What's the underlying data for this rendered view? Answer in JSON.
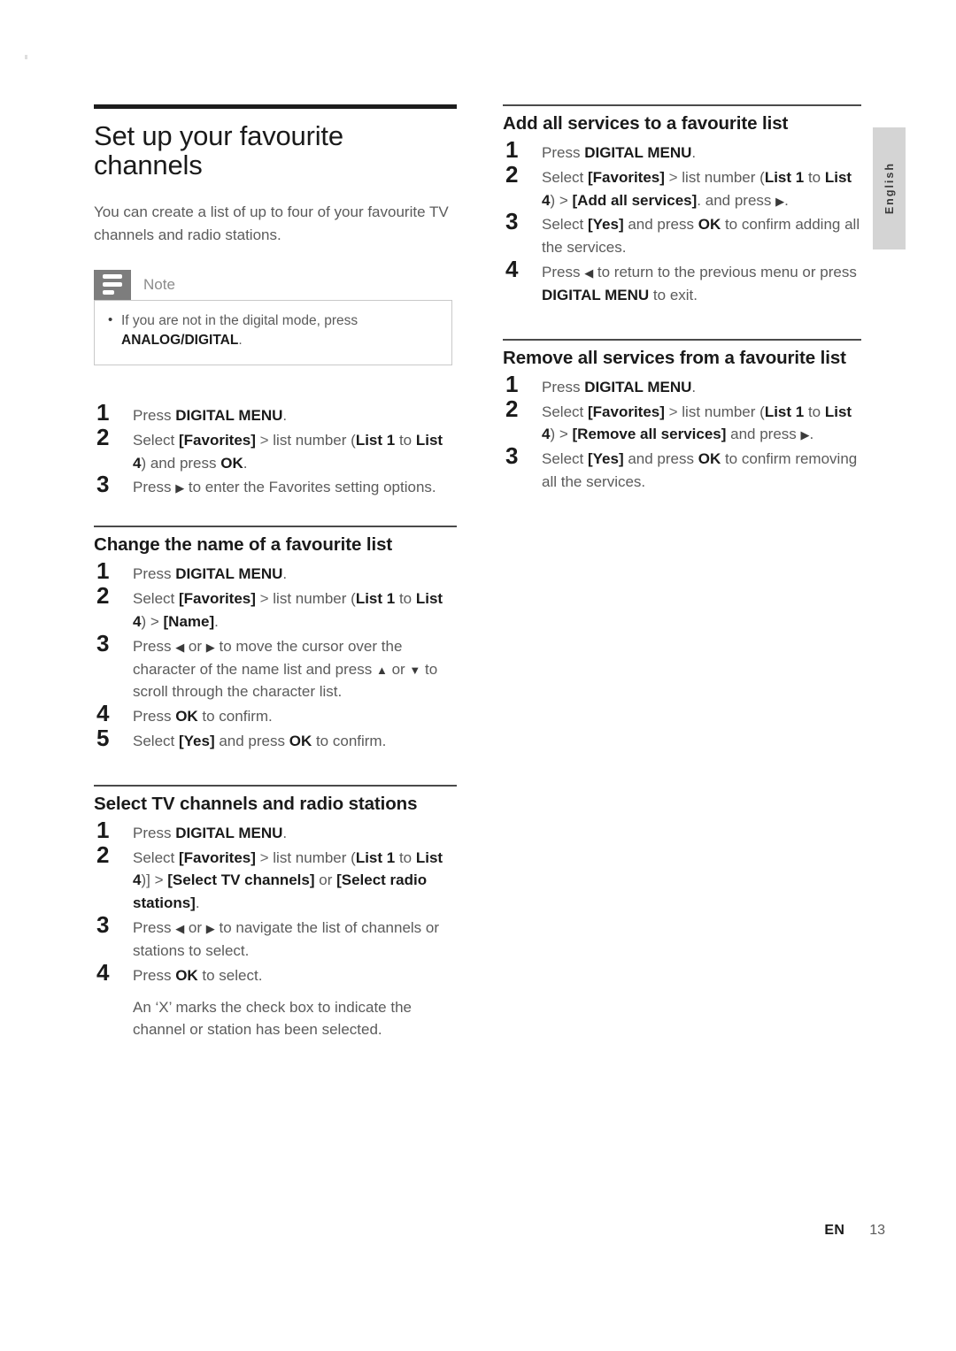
{
  "language_tab": {
    "label": "English"
  },
  "footer": {
    "code": "EN",
    "page": "13"
  },
  "left_column": {
    "title": "Set up your favourite channels",
    "intro": "You can create a list of up to four of your favourite TV channels and radio stations.",
    "note": {
      "label": "Note",
      "items": [
        {
          "text_before": "If you are not in the digital mode, press ",
          "bold": "ANALOG/DIGITAL",
          "text_after": "."
        }
      ]
    },
    "main_steps": [
      {
        "n": "1",
        "parts": [
          {
            "t": "Press ",
            "s": "normal"
          },
          {
            "t": "DIGITAL MENU",
            "s": "bold"
          },
          {
            "t": ".",
            "s": "normal"
          }
        ]
      },
      {
        "n": "2",
        "parts": [
          {
            "t": "Select ",
            "s": "normal"
          },
          {
            "t": "[Favorites]",
            "s": "bold"
          },
          {
            "t": " > ",
            "s": "gt"
          },
          {
            "t": "list number (",
            "s": "normal"
          },
          {
            "t": "List 1",
            "s": "bold"
          },
          {
            "t": " to ",
            "s": "normal"
          },
          {
            "t": "List 4",
            "s": "bold"
          },
          {
            "t": ") and press ",
            "s": "normal"
          },
          {
            "t": "OK",
            "s": "bold"
          },
          {
            "t": ".",
            "s": "normal"
          }
        ]
      },
      {
        "n": "3",
        "parts": [
          {
            "t": "Press ",
            "s": "normal"
          },
          {
            "t": "▶",
            "s": "arrow"
          },
          {
            "t": " to enter the Favorites setting options.",
            "s": "normal"
          }
        ]
      }
    ],
    "sections": [
      {
        "heading": "Change the name of a favourite list",
        "steps": [
          {
            "n": "1",
            "parts": [
              {
                "t": "Press ",
                "s": "normal"
              },
              {
                "t": "DIGITAL MENU",
                "s": "bold"
              },
              {
                "t": ".",
                "s": "normal"
              }
            ]
          },
          {
            "n": "2",
            "parts": [
              {
                "t": "Select ",
                "s": "normal"
              },
              {
                "t": "[Favorites]",
                "s": "bold"
              },
              {
                "t": " > ",
                "s": "gt"
              },
              {
                "t": "list number (",
                "s": "normal"
              },
              {
                "t": "List 1",
                "s": "bold"
              },
              {
                "t": " to ",
                "s": "normal"
              },
              {
                "t": "List 4",
                "s": "bold"
              },
              {
                "t": ") > ",
                "s": "normal"
              },
              {
                "t": "[Name]",
                "s": "bold"
              },
              {
                "t": ".",
                "s": "normal"
              }
            ]
          },
          {
            "n": "3",
            "parts": [
              {
                "t": "Press ",
                "s": "normal"
              },
              {
                "t": "◀",
                "s": "arrow"
              },
              {
                "t": " or ",
                "s": "normal"
              },
              {
                "t": "▶",
                "s": "arrow"
              },
              {
                "t": " to move the cursor over the character of the name list and press  ",
                "s": "normal"
              },
              {
                "t": "▲",
                "s": "arrow"
              },
              {
                "t": " or ",
                "s": "normal"
              },
              {
                "t": "▼",
                "s": "arrow"
              },
              {
                "t": " to scroll through the character list.",
                "s": "normal"
              }
            ]
          },
          {
            "n": "4",
            "parts": [
              {
                "t": "Press ",
                "s": "normal"
              },
              {
                "t": "OK",
                "s": "bold"
              },
              {
                "t": " to confirm.",
                "s": "normal"
              }
            ]
          },
          {
            "n": "5",
            "parts": [
              {
                "t": "Select ",
                "s": "normal"
              },
              {
                "t": "[Yes]",
                "s": "bold"
              },
              {
                "t": " and press ",
                "s": "normal"
              },
              {
                "t": "OK",
                "s": "bold"
              },
              {
                "t": " to confirm.",
                "s": "normal"
              }
            ]
          }
        ]
      },
      {
        "heading": "Select TV channels and radio stations",
        "steps": [
          {
            "n": "1",
            "parts": [
              {
                "t": "Press ",
                "s": "normal"
              },
              {
                "t": "DIGITAL MENU",
                "s": "bold"
              },
              {
                "t": ".",
                "s": "normal"
              }
            ]
          },
          {
            "n": "2",
            "parts": [
              {
                "t": "Select ",
                "s": "normal"
              },
              {
                "t": "[Favorites]",
                "s": "bold"
              },
              {
                "t": " > ",
                "s": "gt"
              },
              {
                "t": "list number (",
                "s": "normal"
              },
              {
                "t": "List 1",
                "s": "bold"
              },
              {
                "t": " to ",
                "s": "normal"
              },
              {
                "t": "List 4",
                "s": "bold"
              },
              {
                "t": ")] > ",
                "s": "normal"
              },
              {
                "t": "[Select TV channels]",
                "s": "bold"
              },
              {
                "t": " or ",
                "s": "normal"
              },
              {
                "t": "[Select radio stations]",
                "s": "bold"
              },
              {
                "t": ".",
                "s": "normal"
              }
            ]
          },
          {
            "n": "3",
            "parts": [
              {
                "t": "Press ",
                "s": "normal"
              },
              {
                "t": "◀",
                "s": "arrow"
              },
              {
                "t": " or ",
                "s": "normal"
              },
              {
                "t": "▶",
                "s": "arrow"
              },
              {
                "t": " to navigate the list of channels or stations to select.",
                "s": "normal"
              }
            ]
          },
          {
            "n": "4",
            "parts": [
              {
                "t": "Press ",
                "s": "normal"
              },
              {
                "t": "OK",
                "s": "bold"
              },
              {
                "t": " to select.",
                "s": "normal"
              }
            ]
          },
          {
            "n": "",
            "continuation": true,
            "parts": [
              {
                "t": "An ‘X’ marks the check box to indicate the channel or station has been selected.",
                "s": "normal"
              }
            ]
          }
        ]
      }
    ]
  },
  "right_column": {
    "sections": [
      {
        "heading": "Add all services to a favourite list",
        "steps": [
          {
            "n": "1",
            "parts": [
              {
                "t": "Press ",
                "s": "normal"
              },
              {
                "t": "DIGITAL MENU",
                "s": "bold"
              },
              {
                "t": ".",
                "s": "normal"
              }
            ]
          },
          {
            "n": "2",
            "parts": [
              {
                "t": "Select ",
                "s": "normal"
              },
              {
                "t": "[Favorites]",
                "s": "bold"
              },
              {
                "t": " > ",
                "s": "gt"
              },
              {
                "t": "list number (",
                "s": "normal"
              },
              {
                "t": "List 1",
                "s": "bold"
              },
              {
                "t": " to ",
                "s": "normal"
              },
              {
                "t": "List 4",
                "s": "bold"
              },
              {
                "t": ") > ",
                "s": "normal"
              },
              {
                "t": "[Add all services]",
                "s": "bold"
              },
              {
                "t": ". and press ",
                "s": "normal"
              },
              {
                "t": "▶",
                "s": "arrow"
              },
              {
                "t": ".",
                "s": "normal"
              }
            ]
          },
          {
            "n": "3",
            "parts": [
              {
                "t": "Select ",
                "s": "normal"
              },
              {
                "t": "[Yes]",
                "s": "bold"
              },
              {
                "t": " and press ",
                "s": "normal"
              },
              {
                "t": "OK",
                "s": "bold"
              },
              {
                "t": " to confirm adding all the services.",
                "s": "normal"
              }
            ]
          },
          {
            "n": "4",
            "parts": [
              {
                "t": "Press ",
                "s": "normal"
              },
              {
                "t": "◀",
                "s": "arrow"
              },
              {
                "t": " to return to the previous menu or press ",
                "s": "normal"
              },
              {
                "t": "DIGITAL MENU",
                "s": "bold"
              },
              {
                "t": " to exit.",
                "s": "normal"
              }
            ]
          }
        ]
      },
      {
        "heading": "Remove all services from a favourite list",
        "steps": [
          {
            "n": "1",
            "parts": [
              {
                "t": "Press ",
                "s": "normal"
              },
              {
                "t": "DIGITAL MENU",
                "s": "bold"
              },
              {
                "t": ".",
                "s": "normal"
              }
            ]
          },
          {
            "n": "2",
            "parts": [
              {
                "t": "Select ",
                "s": "normal"
              },
              {
                "t": "[Favorites]",
                "s": "bold"
              },
              {
                "t": " > ",
                "s": "gt"
              },
              {
                "t": "list number (",
                "s": "normal"
              },
              {
                "t": "List 1",
                "s": "bold"
              },
              {
                "t": " to ",
                "s": "normal"
              },
              {
                "t": "List 4",
                "s": "bold"
              },
              {
                "t": ") > ",
                "s": "normal"
              },
              {
                "t": "[Remove all services]",
                "s": "bold"
              },
              {
                "t": " and press ",
                "s": "normal"
              },
              {
                "t": "▶",
                "s": "arrow"
              },
              {
                "t": ".",
                "s": "normal"
              }
            ]
          },
          {
            "n": "3",
            "parts": [
              {
                "t": "Select ",
                "s": "normal"
              },
              {
                "t": "[Yes]",
                "s": "bold"
              },
              {
                "t": " and press ",
                "s": "normal"
              },
              {
                "t": "OK",
                "s": "bold"
              },
              {
                "t": " to confirm removing all the services.",
                "s": "normal"
              }
            ]
          }
        ]
      }
    ]
  }
}
